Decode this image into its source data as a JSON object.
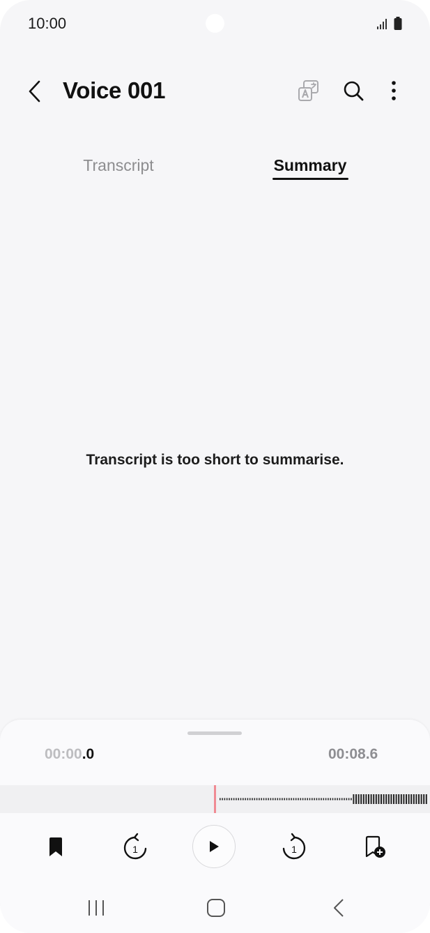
{
  "status_bar": {
    "time": "10:00"
  },
  "header": {
    "title": "Voice 001"
  },
  "tabs": [
    {
      "label": "Transcript",
      "active": false
    },
    {
      "label": "Summary",
      "active": true
    }
  ],
  "content": {
    "message": "Transcript is too short to summarise."
  },
  "player": {
    "current_time_dim": "00:00",
    "current_time_bright": ".0",
    "total_time": "00:08.6",
    "skip_back_seconds": "1",
    "skip_forward_seconds": "1"
  },
  "icons": {
    "back": "chevron-left-icon",
    "translate": "translate-icon",
    "search": "search-icon",
    "more": "more-vertical-icon",
    "bookmark": "bookmark-icon",
    "rewind": "rewind-1s-icon",
    "play": "play-icon",
    "forward": "forward-1s-icon",
    "add_bookmark": "add-bookmark-icon"
  },
  "colors": {
    "background": "#f6f6f8",
    "playhead": "#f08b94",
    "text": "#111111",
    "muted": "#8d8d8f"
  }
}
